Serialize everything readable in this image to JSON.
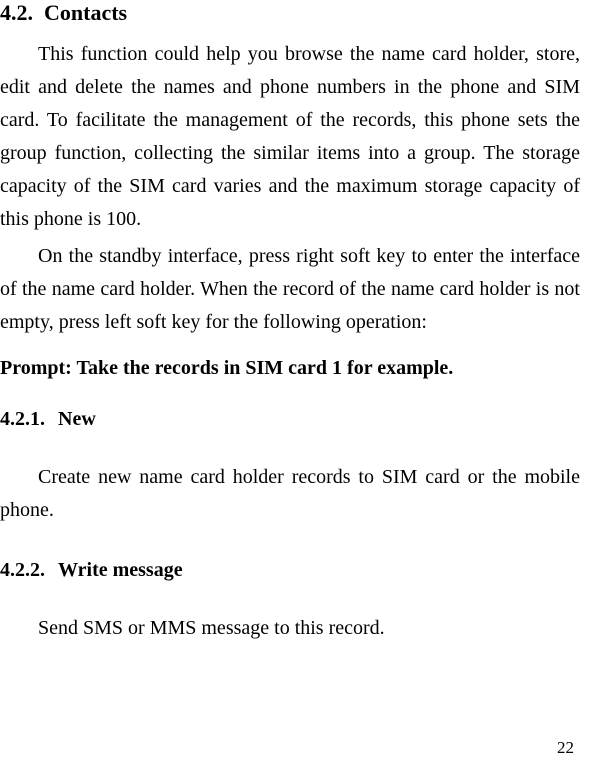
{
  "section": {
    "number": "4.2.",
    "title": "Contacts"
  },
  "paragraphs": {
    "p1": "This function could help you browse the name card holder, store, edit and delete the names and phone numbers in the phone and SIM card. To facilitate the management of the records, this phone sets the group function, collecting the similar items into a group. The storage capacity of the SIM card varies and the maximum storage capacity of this phone is 100.",
    "p2": "On the standby interface, press right soft key to enter the interface of the name card holder. When the record of the name card holder is not empty, press left soft key for the following operation:"
  },
  "prompt": "Prompt: Take the records in SIM card 1 for example.",
  "subsections": [
    {
      "number": "4.2.1.",
      "title": "New",
      "body": "Create new name card holder records to SIM card or the mobile phone."
    },
    {
      "number": "4.2.2.",
      "title": "Write message",
      "body": "Send SMS or MMS message to this record."
    }
  ],
  "page_number": "22"
}
